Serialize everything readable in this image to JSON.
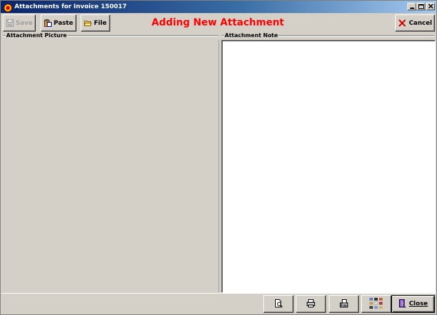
{
  "window": {
    "title": "Attachments for Invoice 150017"
  },
  "toolbar": {
    "save_label": "Save",
    "paste_label": "Paste",
    "file_label": "File",
    "heading": "Adding New Attachment",
    "cancel_label": "Cancel"
  },
  "panels": {
    "picture_label": "Attachment Picture",
    "note_label": "Attachment Note"
  },
  "bottom": {
    "close_label": "Close"
  },
  "colors": {
    "heading": "#ff0000",
    "titlebar_start": "#0a246a",
    "titlebar_end": "#a6caf0",
    "face": "#d4d0c8",
    "cancel_icon": "#cc0000"
  },
  "icons": {
    "app": "app-icon",
    "save": "floppy-disk-icon",
    "paste": "clipboard-paste-icon",
    "file": "folder-open-icon",
    "cancel": "red-x-icon",
    "preview": "print-preview-icon",
    "print": "printer-icon",
    "fax": "fax-icon",
    "thumbnails": "thumbnail-grid-icon",
    "close": "door-exit-icon"
  }
}
